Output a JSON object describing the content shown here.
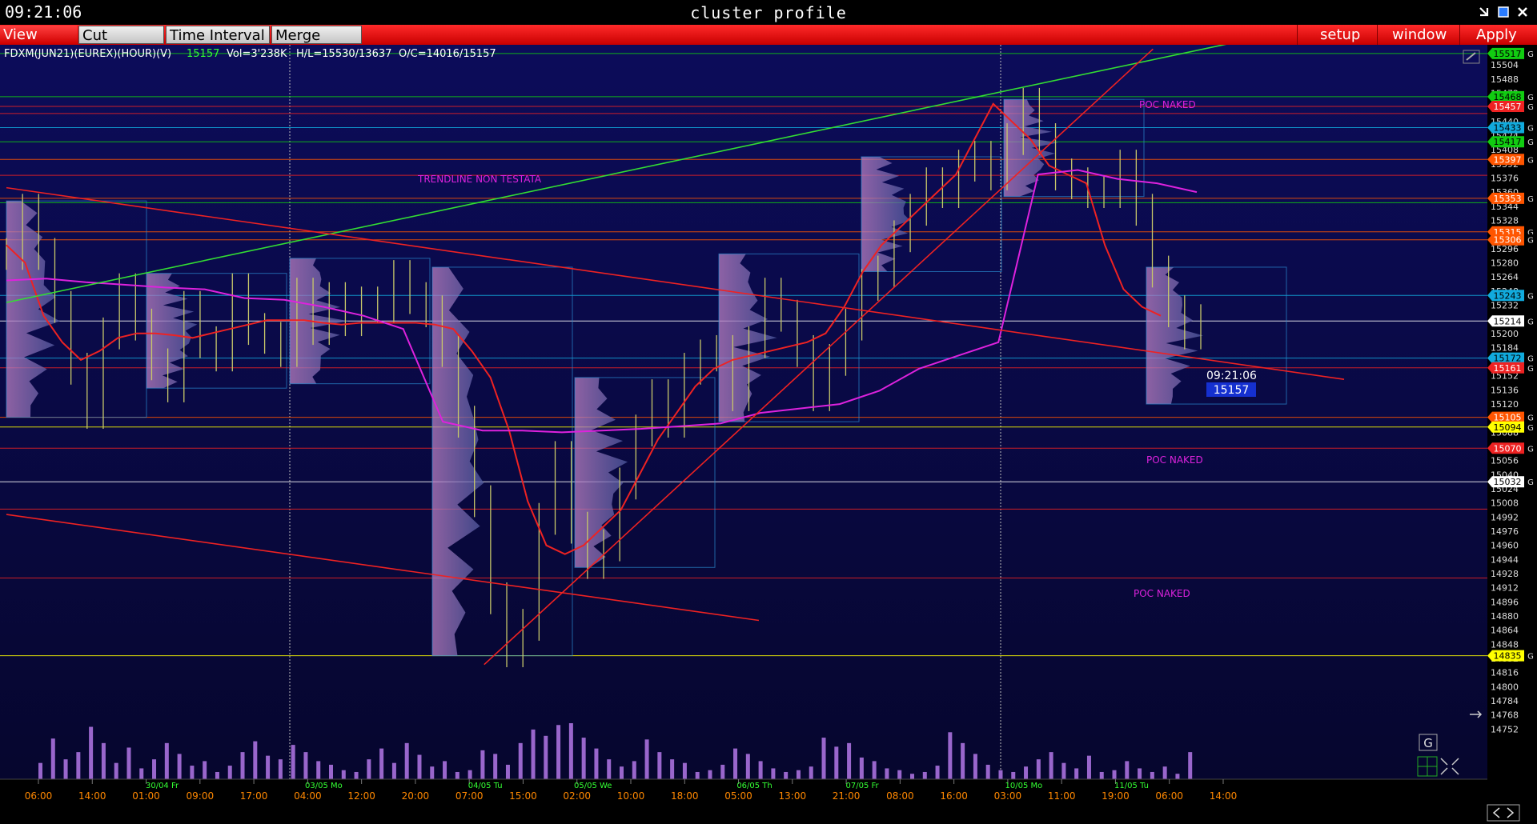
{
  "window": {
    "clock": "09:21:06",
    "title": "cluster profile"
  },
  "toolbar": {
    "view_dom": "View DOM",
    "cut_breaks": "Cut Breaks",
    "time_interval": "Time Interval",
    "merge": "Merge Contr",
    "setup": "setup",
    "window": "window",
    "apply": "Apply"
  },
  "info": {
    "symbol": "FDXM(JUN21)(EUREX)(HOUR)(V)",
    "last": "15157",
    "vol": "Vol=3'238K",
    "hl": "H/L=15530/13637",
    "oc": "O/C=14016/15157"
  },
  "colors": {
    "bg": "#0a0a44",
    "plot_bg": "#0a0a4a",
    "green_line": "#33dd33",
    "red_line": "#ee2222",
    "vwap": "#dd22dd",
    "price_tag": "#1530d0"
  },
  "annotations": {
    "trend": "TRENDLINE NON TESTATA",
    "poc1": "POC NAKED",
    "poc2": "POC NAKED",
    "poc3": "POC NAKED"
  },
  "current": {
    "time": "09:21:06",
    "price": "15157"
  },
  "chart_data": {
    "type": "line",
    "ylim": [
      14745,
      15525
    ],
    "y_ticks": [
      15504,
      15488,
      15472,
      15456,
      15440,
      15424,
      15408,
      15392,
      15376,
      15360,
      15344,
      15328,
      15312,
      15296,
      15280,
      15264,
      15248,
      15232,
      15216,
      15200,
      15184,
      15168,
      15152,
      15136,
      15120,
      15104,
      15088,
      15072,
      15056,
      15040,
      15024,
      15008,
      14992,
      14976,
      14960,
      14944,
      14928,
      14912,
      14896,
      14880,
      14864,
      14848,
      14832,
      14816,
      14800,
      14784,
      14768,
      14752
    ],
    "x_labels": [
      {
        "t": "06:00",
        "c": "o"
      },
      {
        "t": "14:00",
        "c": "o"
      },
      {
        "t": "01:00",
        "c": "o",
        "d": "30/04 Fr"
      },
      {
        "t": "09:00",
        "c": "o"
      },
      {
        "t": "17:00",
        "c": "o"
      },
      {
        "t": "04:00",
        "c": "o",
        "d": "03/05 Mo"
      },
      {
        "t": "12:00",
        "c": "o"
      },
      {
        "t": "20:00",
        "c": "o"
      },
      {
        "t": "07:00",
        "c": "o",
        "d": "04/05 Tu"
      },
      {
        "t": "15:00",
        "c": "o"
      },
      {
        "t": "02:00",
        "c": "o",
        "d": "05/05 We"
      },
      {
        "t": "10:00",
        "c": "o"
      },
      {
        "t": "18:00",
        "c": "o"
      },
      {
        "t": "05:00",
        "c": "o",
        "d": "06/05 Th"
      },
      {
        "t": "13:00",
        "c": "o"
      },
      {
        "t": "21:00",
        "c": "o",
        "d": "07/05 Fr"
      },
      {
        "t": "08:00",
        "c": "o"
      },
      {
        "t": "16:00",
        "c": "o"
      },
      {
        "t": "03:00",
        "c": "o",
        "d": "10/05 Mo"
      },
      {
        "t": "11:00",
        "c": "o"
      },
      {
        "t": "19:00",
        "c": "o",
        "d": "11/05 Tu"
      },
      {
        "t": "06:00",
        "c": "o"
      },
      {
        "t": "14:00",
        "c": "o"
      }
    ],
    "levels": [
      {
        "v": 15517,
        "color": "#11cc11",
        "label": "15517"
      },
      {
        "v": 15468,
        "color": "#11cc11",
        "label": "15468"
      },
      {
        "v": 15457,
        "color": "#ee2222",
        "label": "15457"
      },
      {
        "v": 15449,
        "color": "#ee2222",
        "label": ""
      },
      {
        "v": 15433,
        "color": "#11aadd",
        "label": "15433"
      },
      {
        "v": 15417,
        "color": "#11cc11",
        "label": "15417"
      },
      {
        "v": 15397,
        "color": "#ff5500",
        "label": "15397"
      },
      {
        "v": 15379,
        "color": "#ee2222",
        "label": ""
      },
      {
        "v": 15353,
        "color": "#ff5500",
        "label": "15353"
      },
      {
        "v": 15348,
        "color": "#11cc11",
        "label": ""
      },
      {
        "v": 15315,
        "color": "#ff5500",
        "label": "15315"
      },
      {
        "v": 15306,
        "color": "#ff5500",
        "label": "15306"
      },
      {
        "v": 15243,
        "color": "#11aadd",
        "label": "15243"
      },
      {
        "v": 15214,
        "color": "#ffffff",
        "label": "15214"
      },
      {
        "v": 15172,
        "color": "#11aadd",
        "label": "15172"
      },
      {
        "v": 15161,
        "color": "#ee2222",
        "label": "15161"
      },
      {
        "v": 15105,
        "color": "#ff5500",
        "label": "15105"
      },
      {
        "v": 15094,
        "color": "#ffff00",
        "label": "15094"
      },
      {
        "v": 15070,
        "color": "#ee2222",
        "label": "15070"
      },
      {
        "v": 15032,
        "color": "#ffffff",
        "label": "15032"
      },
      {
        "v": 15001,
        "color": "#ee2222",
        "label": ""
      },
      {
        "v": 14923,
        "color": "#ee2222",
        "label": ""
      },
      {
        "v": 14835,
        "color": "#ffff00",
        "label": "14835"
      }
    ],
    "price": [
      15290,
      15340,
      15290,
      15230,
      15160,
      15110,
      15200,
      15250,
      15210,
      15165,
      15140,
      15230,
      15190,
      15175,
      15250,
      15205,
      15195,
      15180,
      15245,
      15205,
      15240,
      15215,
      15235,
      15230,
      15265,
      15240,
      15225,
      15180,
      15100,
      15010,
      14900,
      14840,
      14870,
      14990,
      15060,
      14980,
      14940,
      14960,
      15030,
      15090,
      15130,
      15100,
      15160,
      15175,
      15180,
      15130,
      15190,
      15245,
      15220,
      15180,
      15130,
      15170,
      15210,
      15255,
      15270,
      15310,
      15340,
      15370,
      15360,
      15390,
      15400,
      15380,
      15420,
      15460,
      15420,
      15380,
      15370,
      15360,
      15360,
      15390,
      15340,
      15270,
      15225,
      15200,
      15215
    ],
    "red_ma": [
      15300,
      15280,
      15220,
      15190,
      15170,
      15180,
      15195,
      15200,
      15200,
      15198,
      15195,
      15200,
      15205,
      15210,
      15215,
      15215,
      15215,
      15212,
      15210,
      15212,
      15212,
      15212,
      15212,
      15210,
      15205,
      15180,
      15150,
      15090,
      15010,
      14960,
      14950,
      14960,
      14980,
      15000,
      15040,
      15080,
      15110,
      15140,
      15160,
      15170,
      15175,
      15180,
      15185,
      15190,
      15200,
      15230,
      15270,
      15300,
      15320,
      15340,
      15360,
      15380,
      15420,
      15460,
      15440,
      15420,
      15390,
      15380,
      15370,
      15300,
      15250,
      15230,
      15220
    ],
    "vwap": [
      15260,
      15262,
      15258,
      15255,
      15252,
      15250,
      15240,
      15238,
      15230,
      15220,
      15205,
      15100,
      15090,
      15090,
      15088,
      15090,
      15092,
      15095,
      15098,
      15110,
      15115,
      15120,
      15135,
      15160,
      15175,
      15190,
      15380,
      15385,
      15375,
      15370,
      15360
    ],
    "volume": [
      18,
      45,
      22,
      30,
      58,
      40,
      18,
      35,
      12,
      22,
      40,
      28,
      15,
      20,
      8,
      15,
      30,
      42,
      26,
      22,
      38,
      30,
      20,
      16,
      10,
      8,
      22,
      34,
      18,
      40,
      27,
      14,
      20,
      8,
      10,
      32,
      28,
      16,
      40,
      55,
      48,
      60,
      62,
      46,
      34,
      22,
      14,
      20,
      44,
      30,
      22,
      18,
      8,
      10,
      16,
      34,
      28,
      20,
      12,
      8,
      10,
      14,
      46,
      36,
      40,
      24,
      20,
      12,
      10,
      6,
      8,
      15,
      52,
      40,
      28,
      16,
      10,
      8,
      14,
      22,
      30,
      18,
      12,
      26,
      8,
      10,
      20,
      12,
      8,
      14,
      6,
      30
    ],
    "trendlines": [
      {
        "name": "green",
        "color": "#33dd33",
        "from": {
          "ts": 0,
          "v": 15235
        },
        "to": {
          "ts": 1.03,
          "v": 15530
        }
      },
      {
        "name": "red-down-1",
        "color": "#ee2222",
        "from": {
          "ts": 0,
          "v": 15365
        },
        "to": {
          "ts": 1.12,
          "v": 15148
        }
      },
      {
        "name": "red-up",
        "color": "#ee2222",
        "from": {
          "ts": 0.4,
          "v": 14825
        },
        "to": {
          "ts": 0.96,
          "v": 15522
        }
      },
      {
        "name": "red-down-2",
        "color": "#ee2222",
        "from": {
          "ts": 0,
          "v": 14995
        },
        "to": {
          "ts": 0.63,
          "v": 14875
        }
      }
    ]
  }
}
